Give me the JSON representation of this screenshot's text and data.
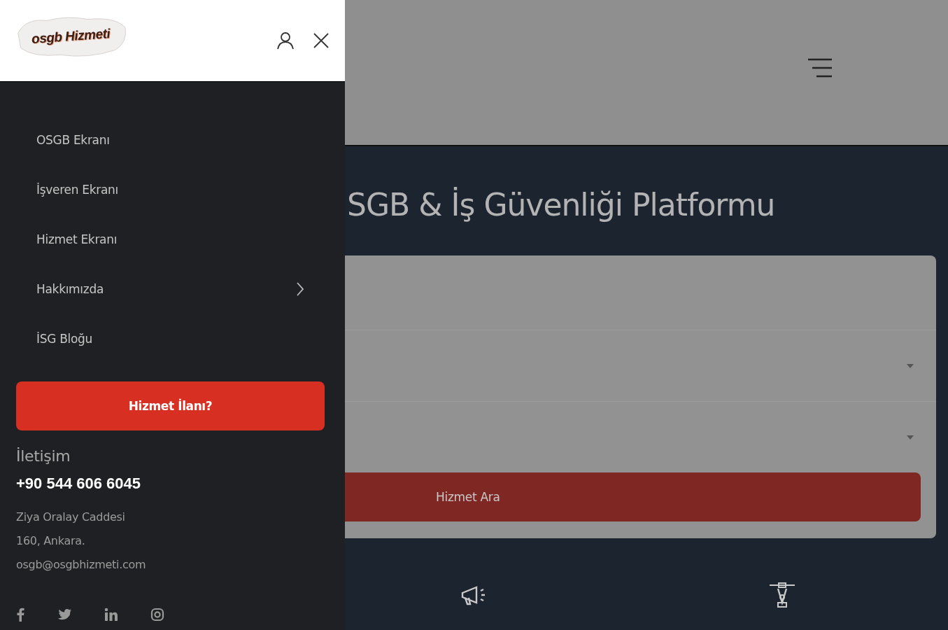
{
  "drawer": {
    "logo": "osgb Hizmeti",
    "menu": [
      {
        "label": "OSGB Ekranı",
        "has_submenu": false
      },
      {
        "label": "İşveren Ekranı",
        "has_submenu": false
      },
      {
        "label": "Hizmet Ekranı",
        "has_submenu": false
      },
      {
        "label": "Hakkımızda",
        "has_submenu": true
      },
      {
        "label": "İSG Bloğu",
        "has_submenu": false
      }
    ],
    "cta_button": "Hizmet İlanı?",
    "contact": {
      "heading": "İletişim",
      "phone": "+90 544 606 6045",
      "address_lines": [
        "Ziya Oralay Caddesi",
        "160, Ankara."
      ],
      "email": "osgb@osgbhizmeti.com"
    },
    "social": [
      {
        "kind": "facebook"
      },
      {
        "kind": "twitter"
      },
      {
        "kind": "linkedin"
      },
      {
        "kind": "instagram"
      }
    ]
  },
  "page": {
    "hero_title": "SGB & İş Güvenliği Platformu",
    "search_card": {
      "fields": [
        {
          "kind": "blank"
        },
        {
          "kind": "dropdown"
        },
        {
          "kind": "dropdown"
        }
      ],
      "button": "Hizmet Ara"
    }
  }
}
